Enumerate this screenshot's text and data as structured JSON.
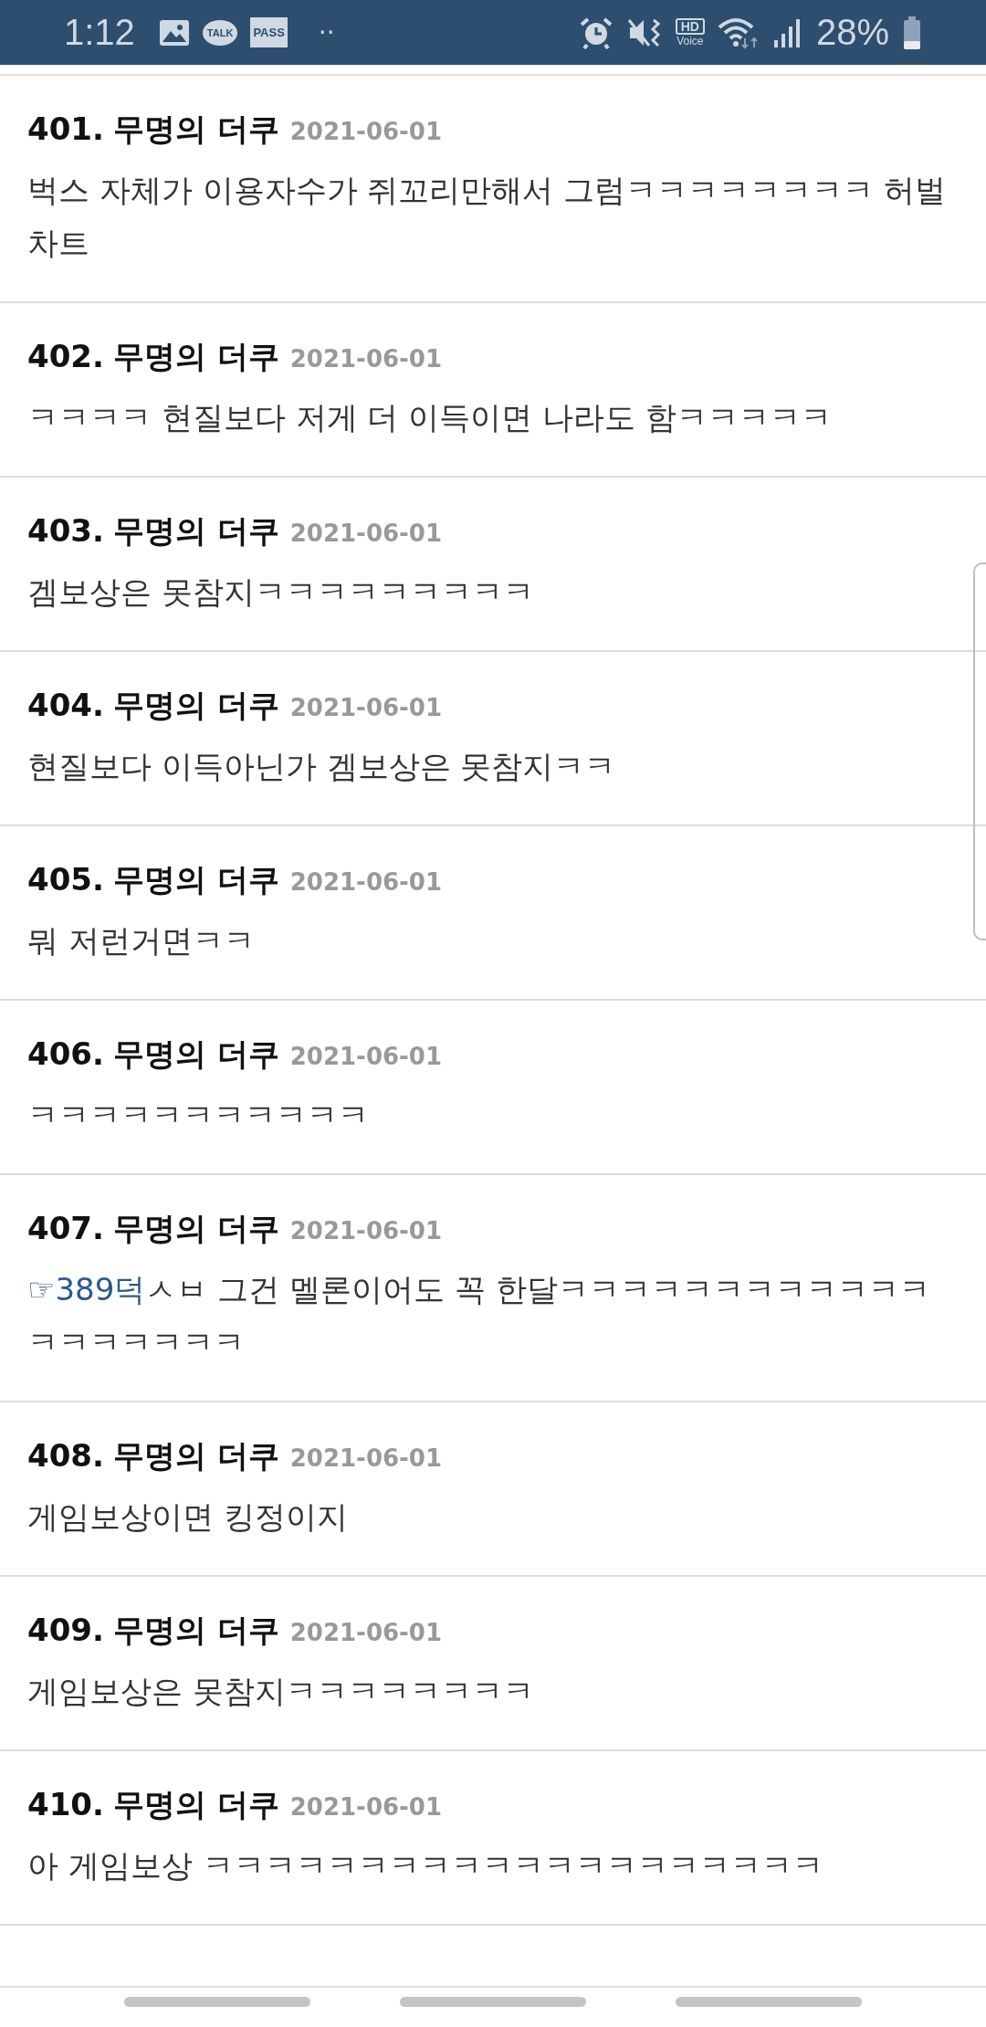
{
  "status_bar": {
    "time": "1:12",
    "talk_label": "TALK",
    "pass_label": "PASS",
    "overflow": "··",
    "hd_label": "HD",
    "voice_label": "Voice",
    "battery": "28%"
  },
  "comments": [
    {
      "number": "401.",
      "author": "무명의 더쿠",
      "date": "2021-06-01",
      "text": "벅스 자체가 이용자수가 쥐꼬리만해서 그럼ㅋㅋㅋㅋㅋㅋㅋㅋ 허벌차트"
    },
    {
      "number": "402.",
      "author": "무명의 더쿠",
      "date": "2021-06-01",
      "text": "ㅋㅋㅋㅋ 현질보다 저게 더 이득이면 나라도 함ㅋㅋㅋㅋㅋ"
    },
    {
      "number": "403.",
      "author": "무명의 더쿠",
      "date": "2021-06-01",
      "text": "겜보상은 못참지ㅋㅋㅋㅋㅋㅋㅋㅋㅋ"
    },
    {
      "number": "404.",
      "author": "무명의 더쿠",
      "date": "2021-06-01",
      "text": "현질보다 이득아닌가 겜보상은 못참지ㅋㅋ"
    },
    {
      "number": "405.",
      "author": "무명의 더쿠",
      "date": "2021-06-01",
      "text": "뭐 저런거면ㅋㅋ"
    },
    {
      "number": "406.",
      "author": "무명의 더쿠",
      "date": "2021-06-01",
      "text": "ㅋㅋㅋㅋㅋㅋㅋㅋㅋㅋㅋ"
    },
    {
      "number": "407.",
      "author": "무명의 더쿠",
      "date": "2021-06-01",
      "reply_link": "☞389덕",
      "text": "ㅅㅂ 그건 멜론이어도 꼭 한달ㅋㅋㅋㅋㅋㅋㅋㅋㅋㅋㅋㅋㅋㅋㅋㅋㅋㅋㅋ"
    },
    {
      "number": "408.",
      "author": "무명의 더쿠",
      "date": "2021-06-01",
      "text": "게임보상이면 킹정이지"
    },
    {
      "number": "409.",
      "author": "무명의 더쿠",
      "date": "2021-06-01",
      "text": "게임보상은 못참지ㅋㅋㅋㅋㅋㅋㅋㅋ"
    },
    {
      "number": "410.",
      "author": "무명의 더쿠",
      "date": "2021-06-01",
      "text": "아 게임보상 ㅋㅋㅋㅋㅋㅋㅋㅋㅋㅋㅋㅋㅋㅋㅋㅋㅋㅋㅋㅋ"
    }
  ]
}
